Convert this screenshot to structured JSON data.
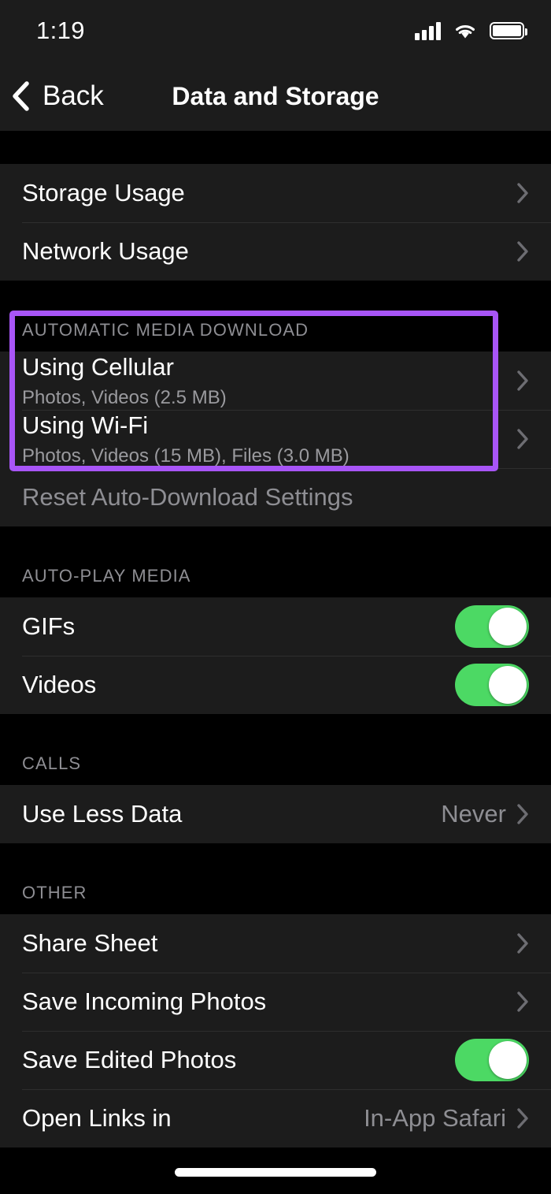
{
  "status_bar": {
    "time": "1:19",
    "cellular_icon": "cellular-signal-icon",
    "wifi_icon": "wifi-icon",
    "battery_icon": "battery-full-icon"
  },
  "nav": {
    "back_label": "Back",
    "back_icon": "chevron-left-icon",
    "title": "Data and Storage"
  },
  "colors": {
    "highlight": "#a855f7",
    "toggle_on": "#4cd964",
    "row_bg": "#1c1c1c",
    "page_bg": "#000000",
    "secondary_text": "#8e8e93"
  },
  "sections": [
    {
      "header": "",
      "rows": [
        {
          "title": "Storage Usage",
          "type": "disclosure"
        },
        {
          "title": "Network Usage",
          "type": "disclosure"
        }
      ]
    },
    {
      "header": "AUTOMATIC MEDIA DOWNLOAD",
      "highlighted": true,
      "rows": [
        {
          "title": "Using Cellular",
          "subtitle": "Photos, Videos (2.5 MB)",
          "type": "disclosure"
        },
        {
          "title": "Using Wi-Fi",
          "subtitle": "Photos, Videos (15 MB), Files (3.0 MB)",
          "type": "disclosure"
        },
        {
          "title": "Reset Auto-Download Settings",
          "type": "action",
          "disabled": true
        }
      ]
    },
    {
      "header": "AUTO-PLAY MEDIA",
      "rows": [
        {
          "title": "GIFs",
          "type": "toggle",
          "value": "on"
        },
        {
          "title": "Videos",
          "type": "toggle",
          "value": "on"
        }
      ]
    },
    {
      "header": "CALLS",
      "rows": [
        {
          "title": "Use Less Data",
          "type": "disclosure",
          "value": "Never"
        }
      ]
    },
    {
      "header": "OTHER",
      "rows": [
        {
          "title": "Share Sheet",
          "type": "disclosure"
        },
        {
          "title": "Save Incoming Photos",
          "type": "disclosure"
        },
        {
          "title": "Save Edited Photos",
          "type": "toggle",
          "value": "on"
        },
        {
          "title": "Open Links in",
          "type": "disclosure",
          "value": "In-App Safari"
        }
      ]
    }
  ]
}
